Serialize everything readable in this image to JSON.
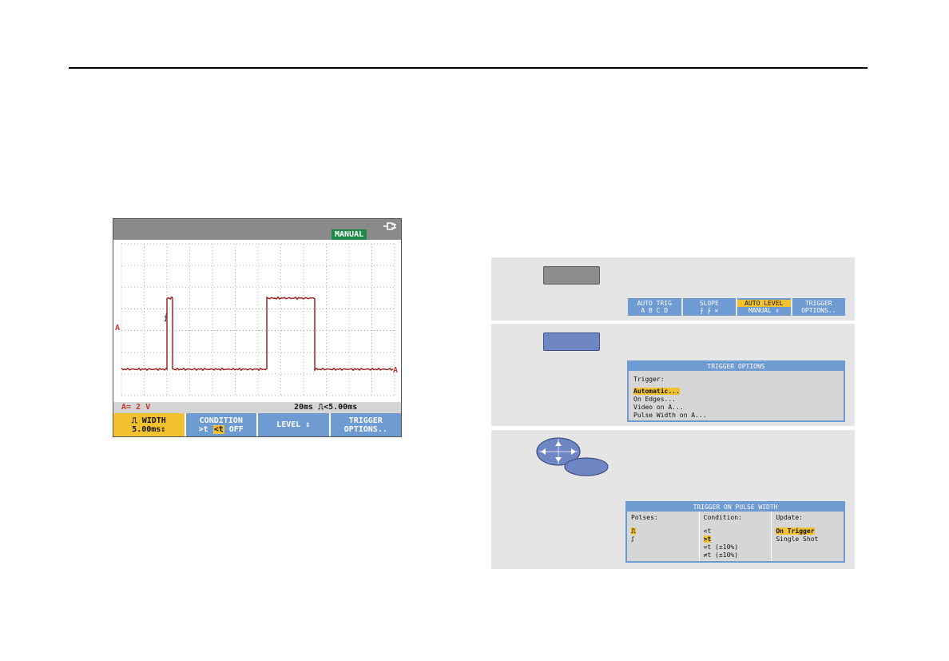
{
  "scope": {
    "status_badge": "MANUAL",
    "channel_marker": "A",
    "trigger_marker": "⨍",
    "status_left": "A= 2 V",
    "status_right": "20ms ⎍<5.00ms",
    "softkeys": [
      {
        "line1": "⎍ WIDTH",
        "line2": "5.00ms⇕"
      },
      {
        "line1": "CONDITION",
        "line2a": ">t ",
        "line2b": "<t",
        "line2c": " OFF"
      },
      {
        "line1": "LEVEL ⇕"
      },
      {
        "line1": "TRIGGER",
        "line2": "OPTIONS.."
      }
    ],
    "colors": {
      "trace": "#8b1a1a",
      "accent": "#f2c12e",
      "softkey": "#6f9bd3",
      "badge": "#1e8a4a"
    }
  },
  "step1": {
    "menubar": [
      {
        "line1": "AUTO TRIG",
        "line2": "A B C D"
      },
      {
        "line1": "SLOPE",
        "line2": "⨍  ⨑  ✕"
      },
      {
        "line1": "AUTO LEVEL",
        "line2": "MANUAL ⇕"
      },
      {
        "line1": "TRIGGER",
        "line2": "OPTIONS.."
      }
    ]
  },
  "step2": {
    "dialog_title": "TRIGGER OPTIONS",
    "label": "Trigger:",
    "options": [
      "Automatic...",
      "On Edges...",
      "Video on A...",
      "Pulse Width on A..."
    ]
  },
  "step3": {
    "dialog_title": "TRIGGER ON PULSE WIDTH",
    "columns": [
      {
        "head": "Polses:",
        "items": [
          "⎍",
          "⎎"
        ]
      },
      {
        "head": "Condition:",
        "items": [
          "<t",
          ">t",
          "=t (±10%)",
          "≠t (±10%)"
        ]
      },
      {
        "head": "Update:",
        "items": [
          "On Trigger",
          "Single Shot"
        ]
      }
    ]
  }
}
